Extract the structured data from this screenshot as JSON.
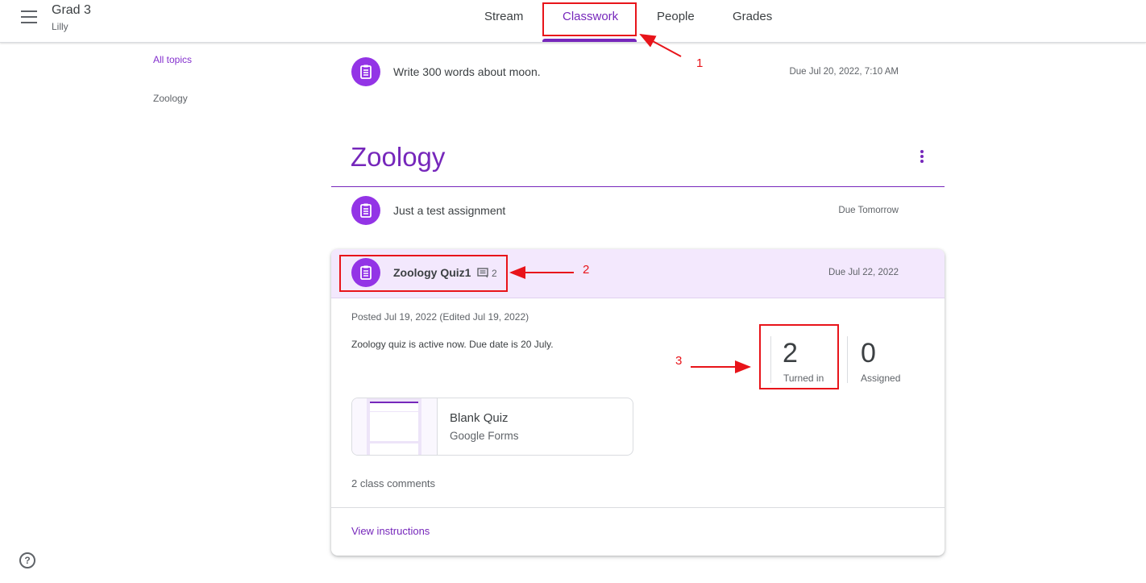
{
  "header": {
    "class_name": "Grad 3",
    "class_section": "Lilly",
    "tabs": [
      "Stream",
      "Classwork",
      "People",
      "Grades"
    ],
    "active_tab": "Classwork"
  },
  "sidebar": {
    "items": [
      {
        "label": "All topics",
        "active": true
      },
      {
        "label": "Zoology",
        "active": false
      }
    ]
  },
  "assignments": {
    "ungrouped": {
      "title": "Write 300 words about moon.",
      "due": "Due Jul 20, 2022, 7:10 AM"
    }
  },
  "topic": {
    "name": "Zoology",
    "items": [
      {
        "title": "Just a test assignment",
        "due": "Due Tomorrow"
      }
    ],
    "expanded": {
      "title": "Zoology Quiz1",
      "comment_count": "2",
      "due": "Due Jul 22, 2022",
      "posted": "Posted Jul 19, 2022 (Edited Jul 19, 2022)",
      "description": "Zoology quiz is active now. Due date is 20 July.",
      "stats": {
        "turned_in": {
          "value": "2",
          "label": "Turned in"
        },
        "assigned": {
          "value": "0",
          "label": "Assigned"
        }
      },
      "attachment": {
        "title": "Blank Quiz",
        "type": "Google Forms"
      },
      "comments_link": "2 class comments",
      "view_link": "View instructions"
    }
  },
  "annotations": [
    "1",
    "2",
    "3"
  ],
  "colors": {
    "accent": "#7627bb",
    "icon_bg": "#9334e6",
    "highlight_bg": "#f3e8fd",
    "annotation": "#e8141a"
  }
}
